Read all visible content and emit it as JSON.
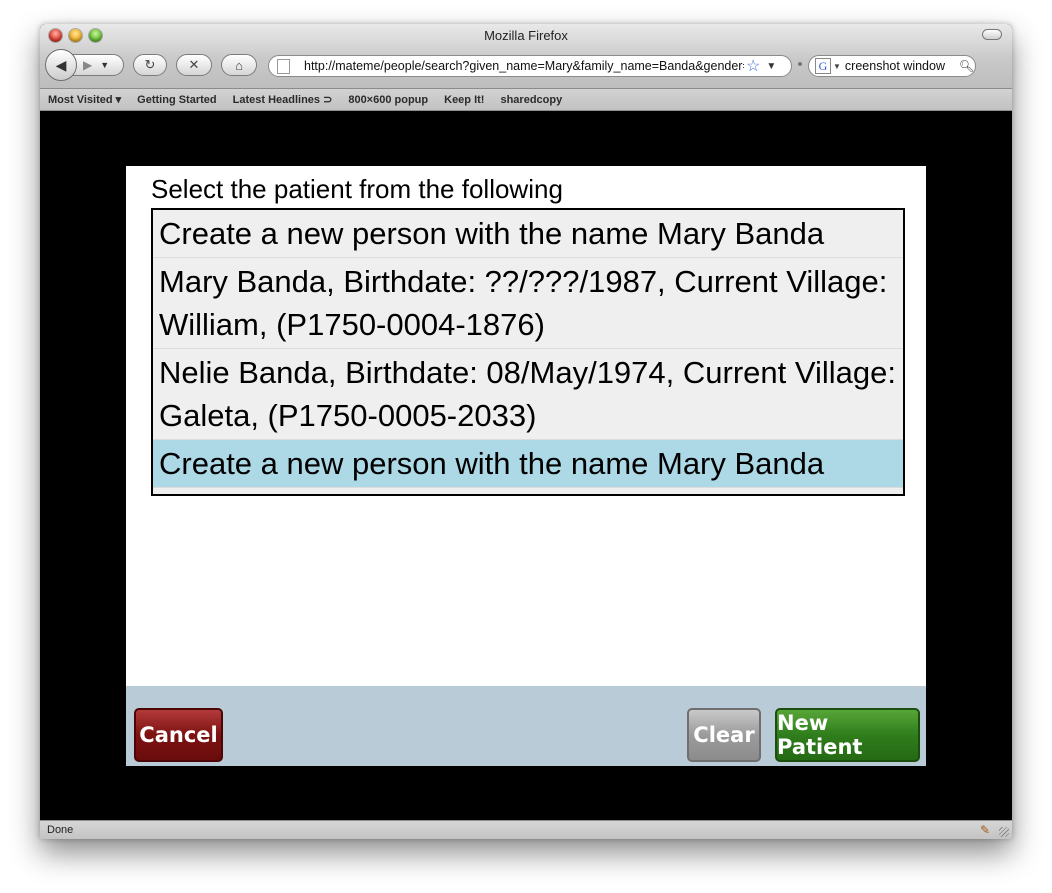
{
  "window": {
    "title": "Mozilla Firefox"
  },
  "toolbar": {
    "url": "http://mateme/people/search?given_name=Mary&family_name=Banda&gender=Female",
    "search_value": "creenshot window"
  },
  "bookmarks": [
    "Most Visited ▾",
    "Getting Started",
    "Latest Headlines ⊃",
    "800×600 popup",
    "Keep It!",
    "sharedcopy"
  ],
  "page": {
    "prompt": "Select the patient from the following",
    "options": [
      "Create a new person with the name Mary Banda",
      "Mary Banda, Birthdate: ??/???/1987, Current Village: William, (P1750-0004-1876)",
      "Nelie Banda, Birthdate: 08/May/1974, Current Village: Galeta, (P1750-0005-2033)",
      "Create a new person with the name Mary Banda"
    ],
    "selected_index": 3,
    "buttons": {
      "cancel": "Cancel",
      "clear": "Clear",
      "new_patient": "New Patient"
    }
  },
  "status": {
    "text": "Done"
  },
  "colors": {
    "selected_row": "#add8e6",
    "cancel": "#7d1212",
    "clear": "#9b9b9b",
    "new_patient": "#2f7d1c",
    "footer": "#b9cbd6"
  }
}
